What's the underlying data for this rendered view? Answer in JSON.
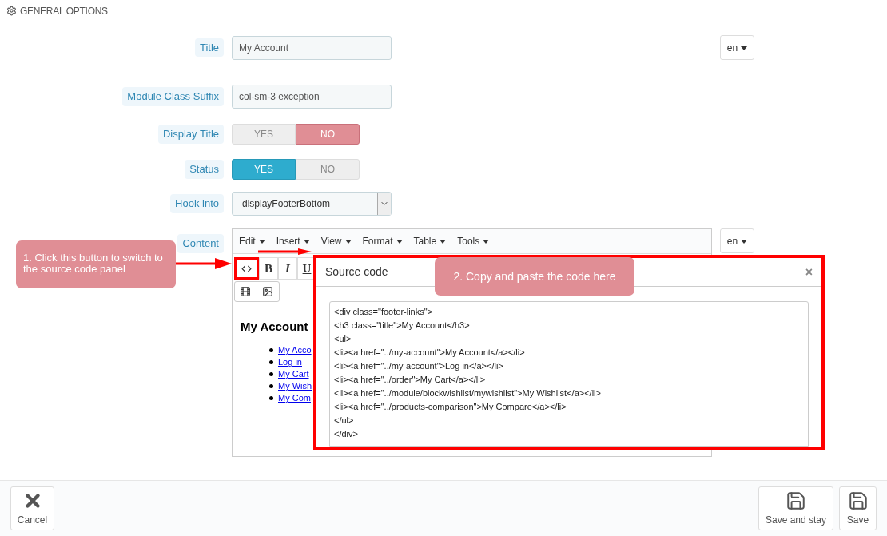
{
  "section": {
    "title": "GENERAL OPTIONS"
  },
  "fields": [
    {
      "kind": "text",
      "label": "Title",
      "value": "My Account",
      "language": "en"
    },
    {
      "kind": "text",
      "label": "Module Class Suffix",
      "value": "col-sm-3 exception"
    },
    {
      "kind": "switch",
      "label": "Display Title",
      "options": [
        {
          "label": "YES",
          "selected": false
        },
        {
          "label": "NO",
          "selected": true
        }
      ]
    },
    {
      "kind": "switch",
      "label": "Status",
      "options": [
        {
          "label": "YES",
          "selected": true
        },
        {
          "label": "NO",
          "selected": false
        }
      ]
    },
    {
      "kind": "select",
      "label": "Hook into",
      "value": "displayFooterBottom"
    }
  ],
  "content": {
    "label": "Content",
    "menu": [
      "Edit",
      "Insert",
      "View",
      "Format",
      "Table",
      "Tools"
    ],
    "toolbar": [
      "B",
      "I",
      "U"
    ],
    "language": "en",
    "preview": {
      "heading": "My Account",
      "links": [
        "My Acco",
        "Log in",
        "My Cart",
        "My Wish",
        "My Com"
      ]
    }
  },
  "dialog": {
    "title": "Source code",
    "close": "×",
    "code": [
      "<div class=\"footer-links\">",
      "<h3 class=\"title\">My Account</h3>",
      "<ul>",
      "<li><a href=\"../my-account\">My Account</a></li>",
      "<li><a href=\"../my-account\">Log in</a></li>",
      "<li><a href=\"../order\">My Cart</a></li>",
      "<li><a href=\"../module/blockwishlist/mywishlist\">My Wishlist</a></li>",
      "<li><a href=\"../products-comparison\">My Compare</a></li>",
      "</ul>",
      "</div>"
    ]
  },
  "callouts": [
    {
      "text": "1. Click this button to switch to the source code panel"
    },
    {
      "text": "2. Copy and paste the code here"
    }
  ],
  "footer": {
    "buttons": [
      {
        "kind": "cancel",
        "label": "Cancel"
      },
      {
        "kind": "save",
        "label": "Save and stay"
      },
      {
        "kind": "save",
        "label": "Save"
      }
    ]
  }
}
